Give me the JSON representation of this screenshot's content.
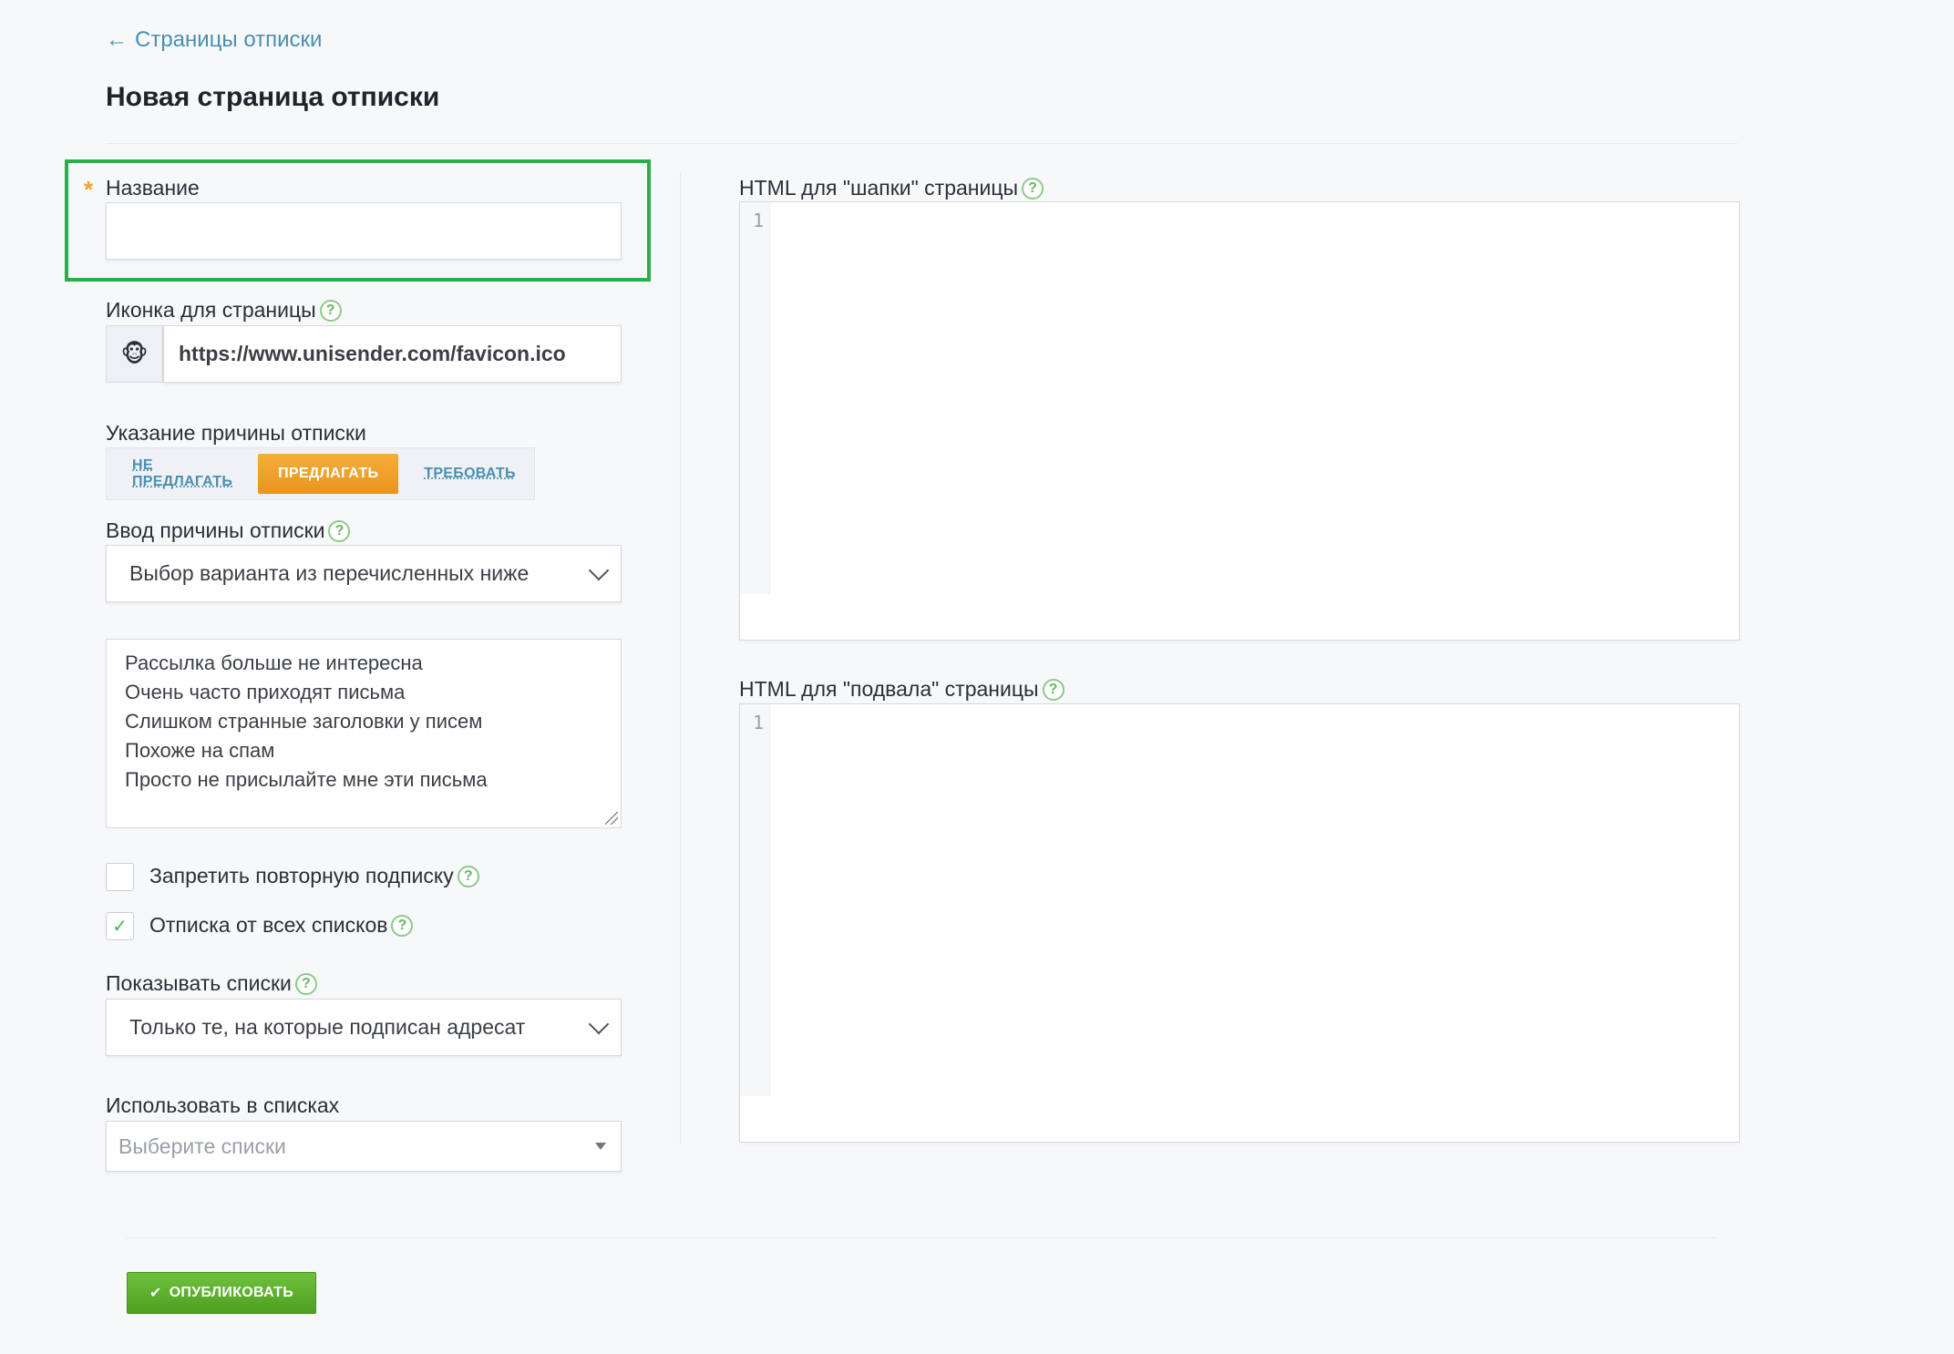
{
  "nav": {
    "back_label": "Страницы отписки",
    "back_icon": "arrow-left-icon"
  },
  "page": {
    "title": "Новая страница отписки"
  },
  "form": {
    "name": {
      "label": "Название",
      "required_marker": "*",
      "value": ""
    },
    "favicon": {
      "label": "Иконка для страницы",
      "value": "https://www.unisender.com/favicon.ico",
      "preview_icon": "monkey-favicon-icon"
    },
    "reason_mode": {
      "label": "Указание причины отписки",
      "options": [
        "НЕ ПРЕДЛАГАТЬ",
        "ПРЕДЛАГАТЬ",
        "ТРЕБОВАТЬ"
      ],
      "selected": "ПРЕДЛАГАТЬ"
    },
    "reason_input": {
      "label": "Ввод причины отписки",
      "selected": "Выбор варианта из перечисленных ниже"
    },
    "reasons_list": [
      "Рассылка больше не интересна",
      "Очень часто приходят письма",
      "Слишком странные заголовки у писем",
      "Похоже на спам",
      "Просто не присылайте мне эти письма"
    ],
    "forbid_resubscribe": {
      "label": "Запретить повторную подписку",
      "checked": false
    },
    "unsubscribe_all": {
      "label": "Отписка от всех списков",
      "checked": true
    },
    "show_lists": {
      "label": "Показывать списки",
      "selected": "Только те, на которые подписан адресат"
    },
    "use_in_lists": {
      "label": "Использовать в списках",
      "placeholder": "Выберите списки"
    },
    "header_html": {
      "label": "HTML для \"шапки\" страницы",
      "line_number": "1"
    },
    "footer_html": {
      "label": "HTML для \"подвала\" страницы",
      "line_number": "1"
    }
  },
  "actions": {
    "publish_label": "ОПУБЛИКОВАТЬ",
    "publish_icon": "checkmark-icon"
  },
  "colors": {
    "accent_orange": "#e8951f",
    "link_blue": "#4a8fb0",
    "publish_green": "#5aad2b",
    "highlight_green": "#27b04a"
  }
}
